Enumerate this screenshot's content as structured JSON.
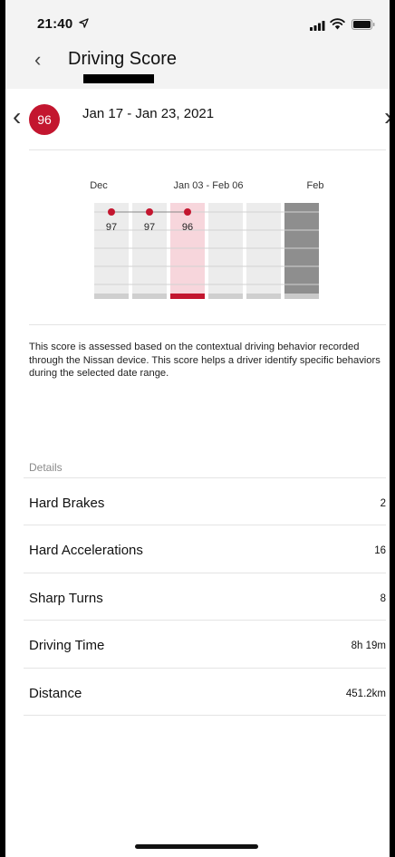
{
  "status_bar": {
    "time": "21:40"
  },
  "header": {
    "title": "Driving Score"
  },
  "week": {
    "score": "96",
    "date_range": "Jan 17 - Jan 23, 2021"
  },
  "chart": {
    "month_labels": [
      "Dec",
      "Jan 03 - Feb 06",
      "Feb"
    ],
    "columns": [
      {
        "score": 97,
        "label": "97",
        "selected": false,
        "has_score": true
      },
      {
        "score": 97,
        "label": "97",
        "selected": false,
        "has_score": true
      },
      {
        "score": 96,
        "label": "96",
        "selected": true,
        "has_score": true
      },
      {
        "score": null,
        "label": "",
        "selected": false,
        "has_score": false
      },
      {
        "score": null,
        "label": "",
        "selected": false,
        "has_score": false
      },
      {
        "score": null,
        "label": "",
        "selected": false,
        "has_score": false,
        "future": true
      }
    ],
    "colors": {
      "accent": "#c3162f",
      "selected_bg": "#f7d6dc",
      "column_bg": "#ececec",
      "future_bg": "#8e8e8e"
    }
  },
  "description": "This score is assessed based on the contextual driving behavior recorded through the Nissan device. This score helps a driver identify specific behaviors during the selected date range.",
  "details": {
    "label": "Details",
    "rows": [
      {
        "label": "Hard Brakes",
        "value": "2"
      },
      {
        "label": "Hard Accelerations",
        "value": "16"
      },
      {
        "label": "Sharp Turns",
        "value": "8"
      },
      {
        "label": "Driving Time",
        "value": "8h 19m"
      },
      {
        "label": "Distance",
        "value": "451.2km"
      }
    ]
  }
}
